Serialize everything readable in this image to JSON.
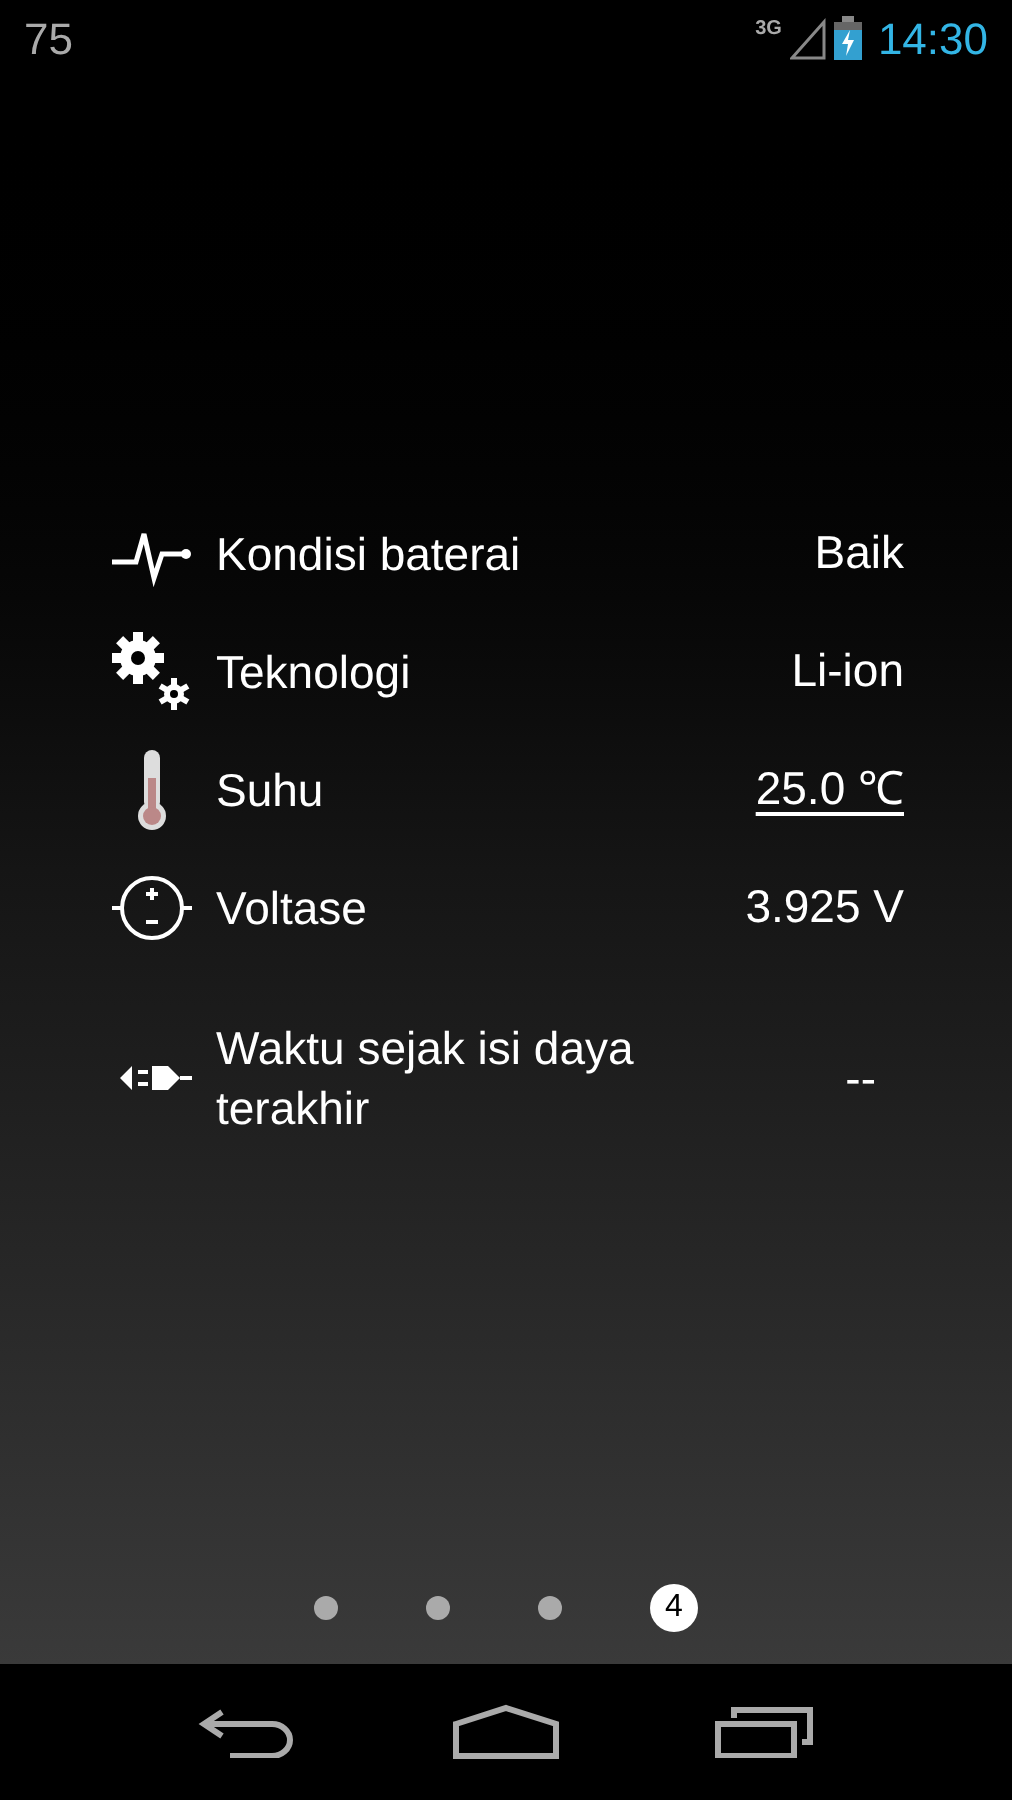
{
  "status_bar": {
    "notification": "75",
    "network": "3G",
    "time": "14:30"
  },
  "rows": [
    {
      "kind": "health",
      "label": "Kondisi baterai",
      "value": "Baik",
      "underlined": false
    },
    {
      "kind": "technology",
      "label": "Teknologi",
      "value": "Li-ion",
      "underlined": false
    },
    {
      "kind": "temperature",
      "label": "Suhu",
      "value": "25.0 ℃",
      "underlined": true
    },
    {
      "kind": "voltage",
      "label": "Voltase",
      "value": "3.925 V",
      "underlined": false
    },
    {
      "kind": "plug",
      "label": "Waktu sejak isi daya terakhir",
      "value": "--",
      "underlined": false
    }
  ],
  "pages": [
    {
      "selected": false
    },
    {
      "selected": false
    },
    {
      "selected": false
    },
    {
      "selected": true,
      "label": "4"
    }
  ]
}
